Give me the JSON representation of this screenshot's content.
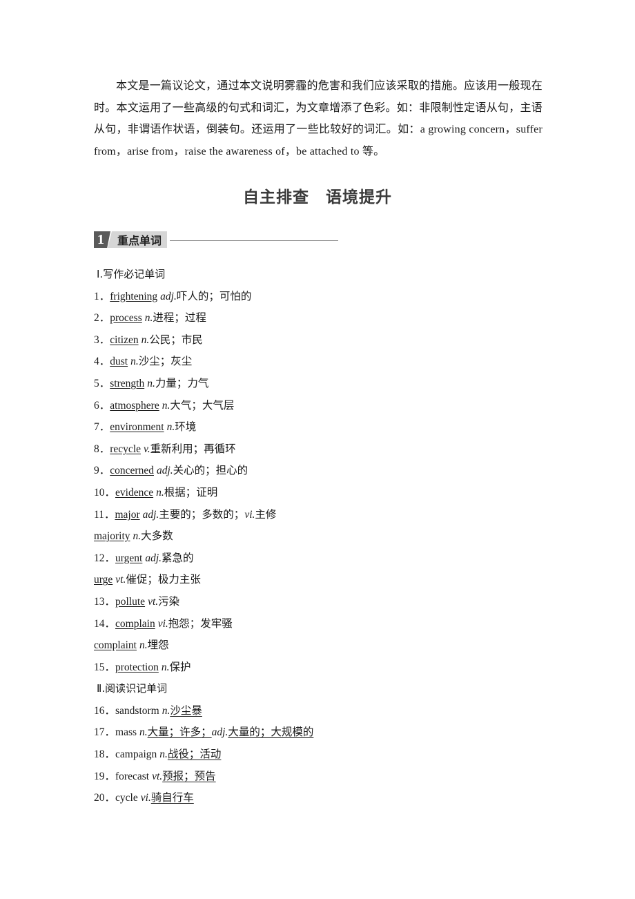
{
  "intro": {
    "text": "本文是一篇议论文，通过本文说明雾霾的危害和我们应该采取的措施。应该用一般现在时。本文运用了一些高级的句式和词汇，为文章增添了色彩。如：非限制性定语从句，主语从句，非谓语作状语，倒装句。还运用了一些比较好的词汇。如：a growing concern，suffer from，arise from，raise the awareness of，be attached to 等。"
  },
  "main_title": "自主排查　语境提升",
  "section": {
    "number": "1",
    "label": "重点单词"
  },
  "writing_vocab": {
    "heading": "Ⅰ.写作必记单词",
    "items": [
      {
        "num": "1",
        "word": "frightening",
        "pos": "adj.",
        "meaning": "吓人的；可怕的"
      },
      {
        "num": "2",
        "word": "process",
        "pos": "n.",
        "meaning": "进程；过程"
      },
      {
        "num": "3",
        "word": "citizen",
        "pos": "n.",
        "meaning": "公民；市民"
      },
      {
        "num": "4",
        "word": "dust",
        "pos": "n.",
        "meaning": "沙尘；灰尘"
      },
      {
        "num": "5",
        "word": "strength",
        "pos": "n.",
        "meaning": "力量；力气"
      },
      {
        "num": "6",
        "word": "atmosphere",
        "pos": "n.",
        "meaning": "大气；大气层"
      },
      {
        "num": "7",
        "word": "environment",
        "pos": "n.",
        "meaning": "环境"
      },
      {
        "num": "8",
        "word": "recycle",
        "pos": "v.",
        "meaning": "重新利用；再循环"
      },
      {
        "num": "9",
        "word": "concerned",
        "pos": "adj.",
        "meaning": "关心的；担心的"
      },
      {
        "num": "10",
        "word": "evidence",
        "pos": "n.",
        "meaning": "根据；证明"
      },
      {
        "num": "11",
        "word": "major",
        "pos": "adj.",
        "meaning": "主要的；多数的；",
        "pos2": "vi.",
        "meaning2": "主修"
      },
      {
        "num": "",
        "word": "majority",
        "pos": "n.",
        "meaning": "大多数"
      },
      {
        "num": "12",
        "word": "urgent",
        "pos": "adj.",
        "meaning": "紧急的"
      },
      {
        "num": "",
        "word": "urge",
        "pos": "vt.",
        "meaning": "催促；极力主张"
      },
      {
        "num": "13",
        "word": "pollute",
        "pos": "vt.",
        "meaning": "污染"
      },
      {
        "num": "14",
        "word": "complain",
        "pos": "vi.",
        "meaning": "抱怨；发牢骚"
      },
      {
        "num": "",
        "word": "complaint",
        "pos": "n.",
        "meaning": "埋怨"
      },
      {
        "num": "15",
        "word": "protection",
        "pos": "n.",
        "meaning": "保护"
      }
    ]
  },
  "reading_vocab": {
    "heading": "Ⅱ.阅读识记单词",
    "items": [
      {
        "num": "16",
        "word": "sandstorm",
        "pos": "n.",
        "meaning": "沙尘暴"
      },
      {
        "num": "17",
        "word": "mass",
        "pos": "n.",
        "meaning": "大量；许多；",
        "pos2": "adj.",
        "meaning2": "大量的；大规模的"
      },
      {
        "num": "18",
        "word": "campaign",
        "pos": "n.",
        "meaning": "战役；活动"
      },
      {
        "num": "19",
        "word": "forecast",
        "pos": "vt.",
        "meaning": "预报；预告"
      },
      {
        "num": "20",
        "word": "cycle",
        "pos": "vi.",
        "meaning": "骑自行车"
      }
    ]
  }
}
